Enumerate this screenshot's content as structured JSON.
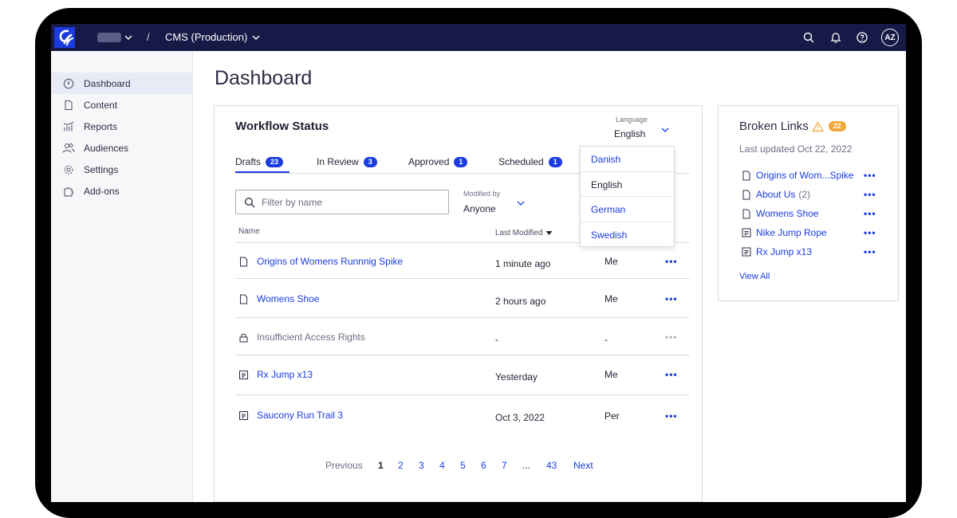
{
  "topbar": {
    "project": "CMS (Production)",
    "separator": "/",
    "avatar_initials": "AZ",
    "icons": [
      "logo-icon",
      "search-icon",
      "bell-icon",
      "help-icon"
    ]
  },
  "sidebar": {
    "items": [
      {
        "label": "Dashboard",
        "icon": "dashboard-icon",
        "active": true
      },
      {
        "label": "Content",
        "icon": "document-icon"
      },
      {
        "label": "Reports",
        "icon": "chart-icon"
      },
      {
        "label": "Audiences",
        "icon": "people-icon"
      },
      {
        "label": "Settings",
        "icon": "gear-icon"
      },
      {
        "label": "Add-ons",
        "icon": "puzzle-icon"
      }
    ]
  },
  "page": {
    "title": "Dashboard"
  },
  "workflow": {
    "title": "Workflow Status",
    "language": {
      "label": "Language",
      "value": "English",
      "options": [
        "Danish",
        "English",
        "German",
        "Swedish"
      ]
    },
    "tabs": [
      {
        "label": "Drafts",
        "count": "23",
        "active": true
      },
      {
        "label": "In Review",
        "count": "3"
      },
      {
        "label": "Approved",
        "count": "1"
      },
      {
        "label": "Scheduled",
        "count": "1"
      }
    ],
    "filter": {
      "placeholder": "Filter by name"
    },
    "modified_by": {
      "label": "Modified by",
      "value": "Anyone"
    },
    "columns": {
      "name": "Name",
      "last_modified": "Last Modified"
    },
    "rows": [
      {
        "name": "Origins of Womens Runnnig Spike",
        "icon": "document-icon",
        "modified": "1 minute ago",
        "by": "Me",
        "more": "•••"
      },
      {
        "name": "Womens Shoe",
        "icon": "document-icon",
        "modified": "2 hours ago",
        "by": "Me",
        "more": "•••"
      },
      {
        "name": "Insufficient Access Rights",
        "icon": "lock-icon",
        "modified": "-",
        "by": "-",
        "more": "•••",
        "disabled": true
      },
      {
        "name": "Rx Jump x13",
        "icon": "block-icon",
        "modified": "Yesterday",
        "by": "Me",
        "more": "•••"
      },
      {
        "name": "Saucony Run Trail 3",
        "icon": "block-icon",
        "modified": "Oct 3, 2022",
        "by": "Per",
        "more": "•••"
      }
    ],
    "pagination": {
      "previous": "Previous",
      "pages": [
        "1",
        "2",
        "3",
        "4",
        "5",
        "6",
        "7",
        "...",
        "43"
      ],
      "current": "1",
      "next": "Next"
    }
  },
  "broken_links": {
    "title": "Broken Links",
    "count": "22",
    "updated": "Last updated Oct 22, 2022",
    "items": [
      {
        "label": "Origins of Wom...Spike",
        "icon": "document-icon",
        "extra": "",
        "more": "•••"
      },
      {
        "label": "About Us",
        "icon": "document-icon",
        "extra": "(2)",
        "more": "•••"
      },
      {
        "label": "Womens Shoe",
        "icon": "document-icon",
        "extra": "",
        "more": "•••"
      },
      {
        "label": "Nike Jump Rope",
        "icon": "block-icon",
        "extra": "",
        "more": "•••"
      },
      {
        "label": "Rx Jump x13",
        "icon": "block-icon",
        "extra": "",
        "more": "•••"
      }
    ],
    "view_all": "View All"
  },
  "colors": {
    "topbar": "#171a46",
    "accent": "#1a3ce0",
    "warning": "#f2a93b"
  }
}
